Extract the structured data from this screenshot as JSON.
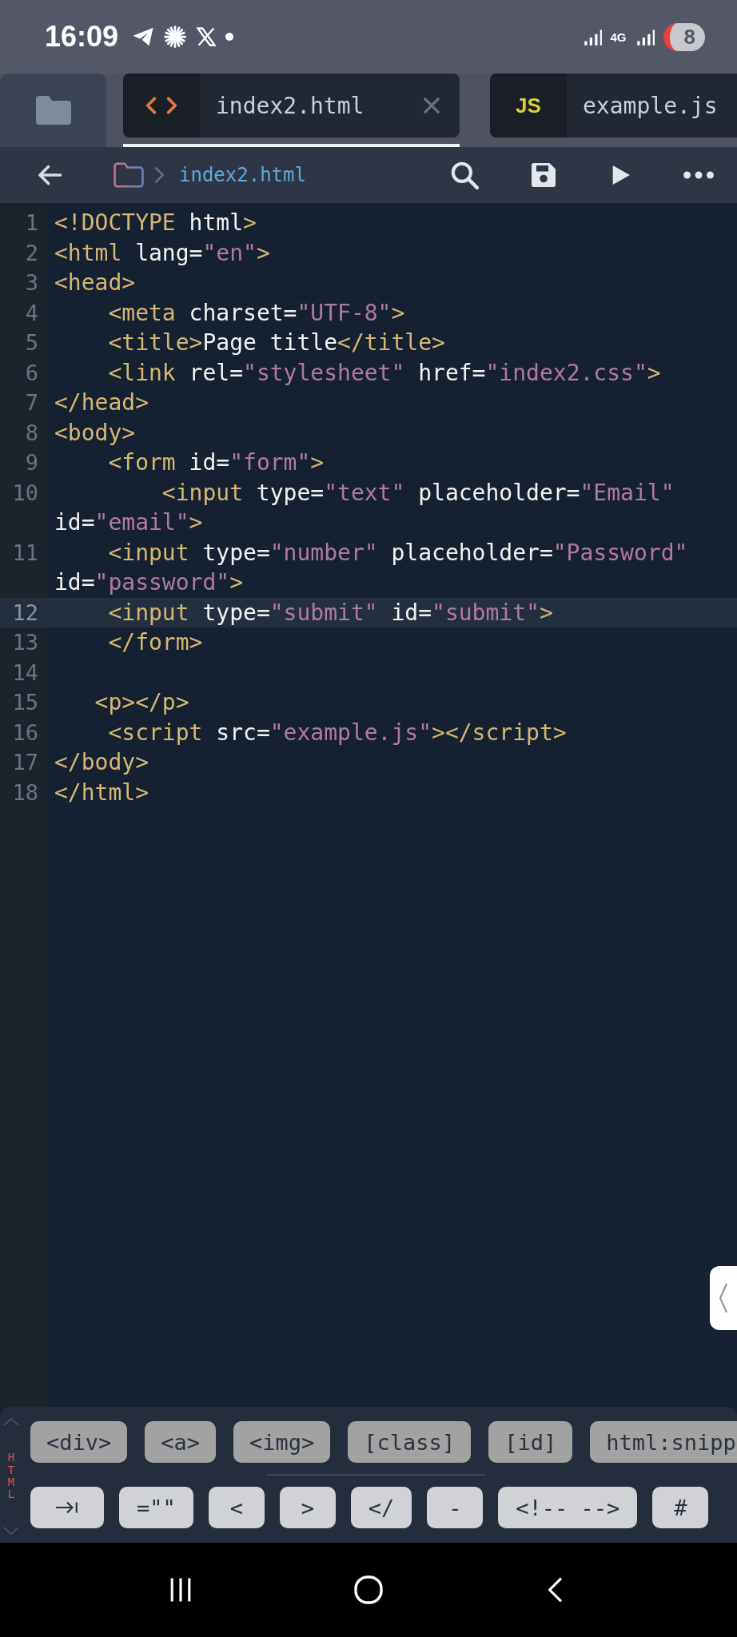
{
  "status_bar": {
    "time": "16:09",
    "network": "4G",
    "battery": "8"
  },
  "tabs": [
    {
      "kind": "html",
      "label": "index2.html",
      "selected": true
    },
    {
      "kind": "js",
      "icon_text": "JS",
      "label": "example.js",
      "selected": false
    }
  ],
  "toolbar": {
    "breadcrumb": "index2.html"
  },
  "editor": {
    "lines": [
      {
        "number": "1",
        "active": false,
        "tokens": [
          {
            "kind": "tag",
            "text": "<!DOCTYPE"
          },
          {
            "kind": "attr",
            "text": " html"
          },
          {
            "kind": "tag",
            "text": ">"
          }
        ]
      },
      {
        "number": "2",
        "active": false,
        "tokens": [
          {
            "kind": "tag",
            "text": "<html"
          },
          {
            "kind": "attr",
            "text": " lang="
          },
          {
            "kind": "string",
            "text": "\"en\""
          },
          {
            "kind": "tag",
            "text": ">"
          }
        ]
      },
      {
        "number": "3",
        "active": false,
        "tokens": [
          {
            "kind": "tag",
            "text": "<head>"
          }
        ]
      },
      {
        "number": "4",
        "active": false,
        "tokens": [
          {
            "kind": "tag",
            "text": "    <meta"
          },
          {
            "kind": "attr",
            "text": " charset="
          },
          {
            "kind": "string",
            "text": "\"UTF-8\""
          },
          {
            "kind": "tag",
            "text": ">"
          }
        ]
      },
      {
        "number": "5",
        "active": false,
        "tokens": [
          {
            "kind": "tag",
            "text": "    <title>"
          },
          {
            "kind": "attr",
            "text": "Page title"
          },
          {
            "kind": "tag",
            "text": "</title>"
          }
        ]
      },
      {
        "number": "6",
        "active": false,
        "tokens": [
          {
            "kind": "tag",
            "text": "    <link"
          },
          {
            "kind": "attr",
            "text": " rel="
          },
          {
            "kind": "string",
            "text": "\"stylesheet\""
          },
          {
            "kind": "attr",
            "text": " href="
          },
          {
            "kind": "string",
            "text": "\"index2.css\""
          },
          {
            "kind": "tag",
            "text": ">"
          }
        ]
      },
      {
        "number": "7",
        "active": false,
        "tokens": [
          {
            "kind": "tag",
            "text": "</head>"
          }
        ]
      },
      {
        "number": "8",
        "active": false,
        "tokens": [
          {
            "kind": "tag",
            "text": "<body>"
          }
        ]
      },
      {
        "number": "9",
        "active": false,
        "tokens": [
          {
            "kind": "tag",
            "text": "    <form"
          },
          {
            "kind": "attr",
            "text": " id="
          },
          {
            "kind": "string",
            "text": "\"form\""
          },
          {
            "kind": "tag",
            "text": ">"
          }
        ]
      },
      {
        "number": "10",
        "active": false,
        "tokens": [
          {
            "kind": "tag",
            "text": "        <input"
          },
          {
            "kind": "attr",
            "text": " type="
          },
          {
            "kind": "string",
            "text": "\"text\""
          },
          {
            "kind": "attr",
            "text": " placeholder="
          },
          {
            "kind": "string",
            "text": "\"Email\""
          },
          {
            "kind": "attr",
            "text": " id="
          },
          {
            "kind": "string",
            "text": "\"email\""
          },
          {
            "kind": "tag",
            "text": ">"
          }
        ]
      },
      {
        "number": "11",
        "active": false,
        "tokens": [
          {
            "kind": "tag",
            "text": "    <input"
          },
          {
            "kind": "attr",
            "text": " type="
          },
          {
            "kind": "string",
            "text": "\"number\""
          },
          {
            "kind": "attr",
            "text": " placeholder="
          },
          {
            "kind": "string",
            "text": "\"Password\""
          },
          {
            "kind": "attr",
            "text": " id="
          },
          {
            "kind": "string",
            "text": "\"password\""
          },
          {
            "kind": "tag",
            "text": ">"
          }
        ]
      },
      {
        "number": "12",
        "active": true,
        "tokens": [
          {
            "kind": "tag",
            "text": "    <input"
          },
          {
            "kind": "attr",
            "text": " type="
          },
          {
            "kind": "string",
            "text": "\"submit\""
          },
          {
            "kind": "attr",
            "text": " id="
          },
          {
            "kind": "string",
            "text": "\"submit\""
          },
          {
            "kind": "tag",
            "text": ">"
          }
        ]
      },
      {
        "number": "13",
        "active": false,
        "tokens": [
          {
            "kind": "tag",
            "text": "    </form>"
          }
        ]
      },
      {
        "number": "14",
        "active": false
      },
      {
        "number": "15",
        "active": false,
        "tokens": [
          {
            "kind": "tag",
            "text": "   <p></p>"
          }
        ]
      },
      {
        "number": "16",
        "active": false,
        "tokens": [
          {
            "kind": "tag",
            "text": "    <script"
          },
          {
            "kind": "attr",
            "text": " src="
          },
          {
            "kind": "string",
            "text": "\"example.js\""
          },
          {
            "kind": "tag",
            "text": "></script>"
          }
        ]
      },
      {
        "number": "17",
        "active": false,
        "tokens": [
          {
            "kind": "tag",
            "text": "</body>"
          }
        ]
      },
      {
        "number": "18",
        "active": false,
        "tokens": [
          {
            "kind": "tag",
            "text": "</html>"
          }
        ]
      }
    ]
  },
  "keyboard": {
    "mode": "HTML",
    "snippets": [
      "<div>",
      "<a>",
      "<img>",
      "[class]",
      "[id]",
      "html:snipp"
    ],
    "symbols": [
      {
        "kind": "tab"
      },
      {
        "kind": "text",
        "text": "=\"\""
      },
      {
        "kind": "text",
        "text": "<"
      },
      {
        "kind": "text",
        "text": ">"
      },
      {
        "kind": "text",
        "text": "</"
      },
      {
        "kind": "text",
        "text": "-"
      },
      {
        "kind": "text",
        "text": "<!-- -->"
      },
      {
        "kind": "text",
        "text": "#"
      }
    ]
  }
}
